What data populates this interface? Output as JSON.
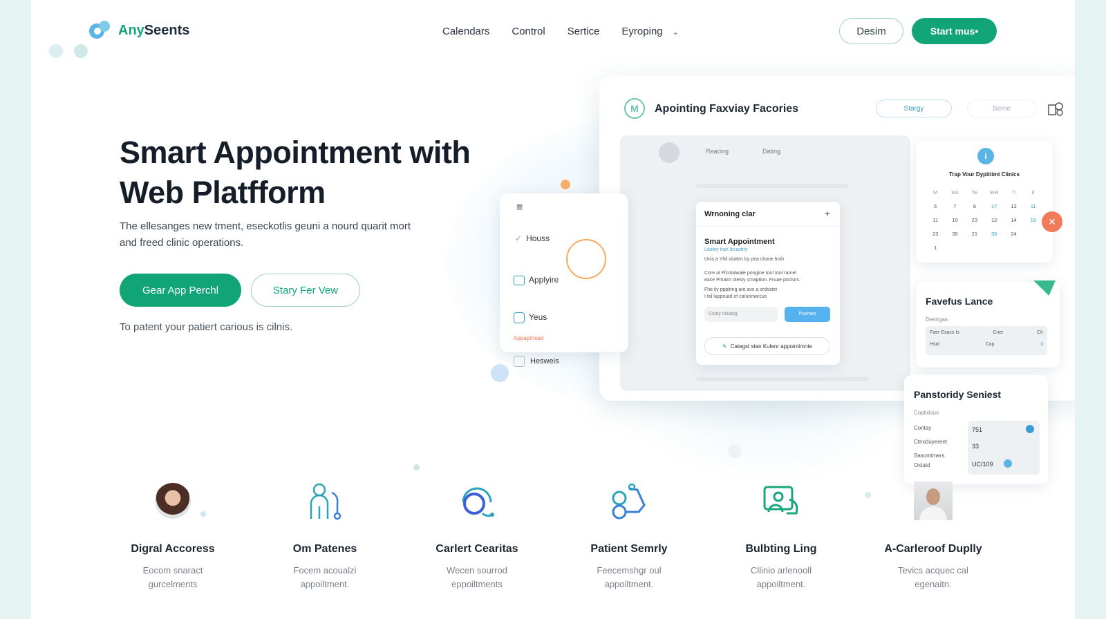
{
  "brand": {
    "name_part1": "Any",
    "name_part2": "Seents"
  },
  "nav": {
    "links": [
      "Calendars",
      "Control",
      "Sertice",
      "Eyroping"
    ],
    "dropdown_chevron": "chevron-down-icon",
    "secondary_button": "Desim",
    "primary_button": "Start mus•"
  },
  "hero": {
    "title_line1": "Smart Appointment with",
    "title_line2": "Web Platfform",
    "subtitle": "The ellesanges new tment, eseckotlis geuni a nourd quarit mort and freed clinic operations.",
    "primary_cta": "Gear App Perchl",
    "secondary_cta": "Stary Fer Vew",
    "note": "To patent your patiert carious is cilnis."
  },
  "dashboard": {
    "title": "Apointing Faxviay Facories",
    "pill_primary": "Stargy",
    "pill_secondary": "Seme",
    "tabs": [
      "Reacing",
      "Dating"
    ],
    "menu": {
      "items": [
        "Houss",
        "Applyire",
        "Yeus",
        "Hesweis"
      ],
      "accent_label": "Appaptrnaid"
    },
    "appointment_card": {
      "header": "Wrnoning clar",
      "title": "Smart Appointment",
      "subtitle": "Lastey tran Iccastrty",
      "line1": "Unis a Yhil oluiten by pea chone fush",
      "line2": "Core al Ffcotalwale poogine tool tool rarnel",
      "line3": "eace Pmaim oteloy cmaption. Fruae pocturs.",
      "line4": "Fhe ily ppplring are avs a ordsstet",
      "line5": "I tal luppruad of ca/oomarcus",
      "input_placeholder": "Cstoy clslang",
      "input_button": "Pusmes",
      "action": "Categst stan Kulenr appointimnte"
    },
    "calendar": {
      "title": "Trap Vour Dypittimt Clinics",
      "days": [
        "M",
        "Mo",
        "Te",
        "Wel",
        "Tl",
        "F"
      ],
      "dates": [
        "6",
        "7",
        "8",
        "17",
        "13",
        "11",
        "11",
        "10",
        "23",
        "12",
        "14",
        "16",
        "23",
        "30",
        "21",
        "30",
        "24",
        "",
        "1",
        "",
        "",
        "",
        "",
        ""
      ]
    },
    "favorites": {
      "title": "Favefus Lance",
      "label": "Denngas",
      "rows": [
        [
          "Faer Esacs Is",
          "Cner",
          "Clr"
        ],
        [
          "Hsal",
          "Cap",
          "1"
        ]
      ]
    },
    "stats": {
      "title": "Panstoridy Seniest",
      "label": "Coptidous",
      "rows": [
        "Contay",
        "Ctnoduyereet",
        "Sasomimers",
        "Oxtatd"
      ],
      "values": [
        "751",
        "33",
        "UC/109"
      ]
    }
  },
  "features": [
    {
      "icon": "avatar-photo",
      "title": "Digral Accoress",
      "desc1": "Eocom snaract",
      "desc2": "gurcelments"
    },
    {
      "icon": "person-stethoscope-icon",
      "title": "Om Patenes",
      "desc1": "Focem acoualzi",
      "desc2": "appoiltment."
    },
    {
      "icon": "headset-icon",
      "title": "Carlert Cearitas",
      "desc1": "Wecen sourrod",
      "desc2": "eppoiltments"
    },
    {
      "icon": "robot-link-icon",
      "title": "Patient Semrly",
      "desc1": "Feecemshgr oul",
      "desc2": "appoiltment."
    },
    {
      "icon": "chat-person-icon",
      "title": "Bulbting Ling",
      "desc1": "Cllinio arlenooll",
      "desc2": "appoiltment."
    },
    {
      "icon": "avatar-photo",
      "title": "A-Carleroof Duplly",
      "desc1": "Tevics acquec cal",
      "desc2": "egenaitn."
    }
  ],
  "colors": {
    "accent": "#10a477",
    "brand_blue": "#5bb4e6",
    "coral": "#f07a5a"
  }
}
